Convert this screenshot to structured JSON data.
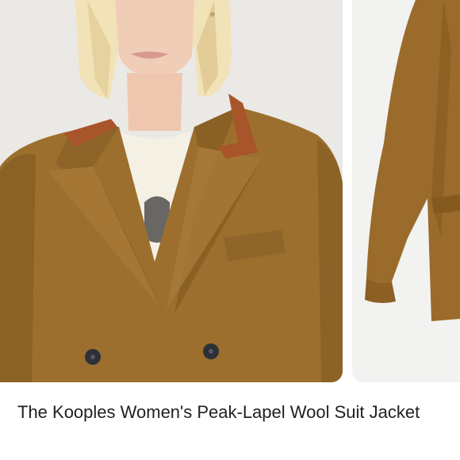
{
  "product": {
    "title": "The Kooples Women's Peak-Lapel Wool Suit Jacket"
  },
  "gallery": {
    "images": [
      {
        "name": "model-wearing-jacket"
      },
      {
        "name": "jacket-product-view"
      }
    ]
  },
  "colors": {
    "jacket": "#9c6f2e",
    "jacket_shadow": "#7d561f",
    "velvet_collar": "#a8552a",
    "background": "#ebe9e6"
  }
}
